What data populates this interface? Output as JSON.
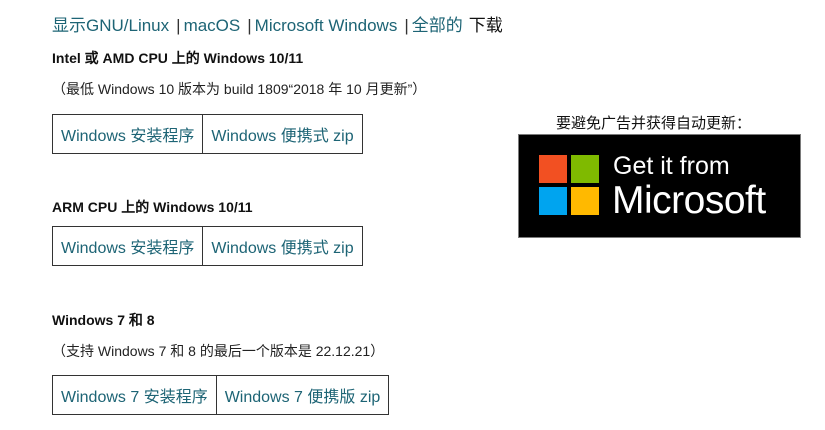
{
  "nav": {
    "links": [
      "显示GNU/Linux",
      "macOS",
      "Microsoft Windows",
      "全部的"
    ],
    "separator": "|",
    "suffix": "下载"
  },
  "sections": [
    {
      "title": "Intel 或 AMD CPU 上的 Windows 10/11",
      "note": "（最低 Windows 10 版本为 build 1809“2018 年 10 月更新”）",
      "buttons": [
        "Windows 安装程序",
        "Windows 便携式 zip"
      ]
    },
    {
      "title": "ARM CPU 上的 Windows 10/11",
      "note": "",
      "buttons": [
        "Windows 安装程序",
        "Windows 便携式 zip"
      ]
    },
    {
      "title": "Windows 7 和 8",
      "note": "（支持 Windows 7 和 8 的最后一个版本是 22.12.21）",
      "buttons": [
        "Windows 7 安装程序",
        "Windows 7 便携版 zip"
      ]
    }
  ],
  "store": {
    "label": "要避免广告并获得自动更新：",
    "badge_line1": "Get it from",
    "badge_line2": "Microsoft",
    "logo_colors": [
      "#f25022",
      "#7fba00",
      "#00a4ef",
      "#ffb900"
    ],
    "icon": "microsoft-logo-icon"
  },
  "colors": {
    "link": "#1d6475",
    "border": "#333333",
    "badge_bg": "#000000"
  }
}
